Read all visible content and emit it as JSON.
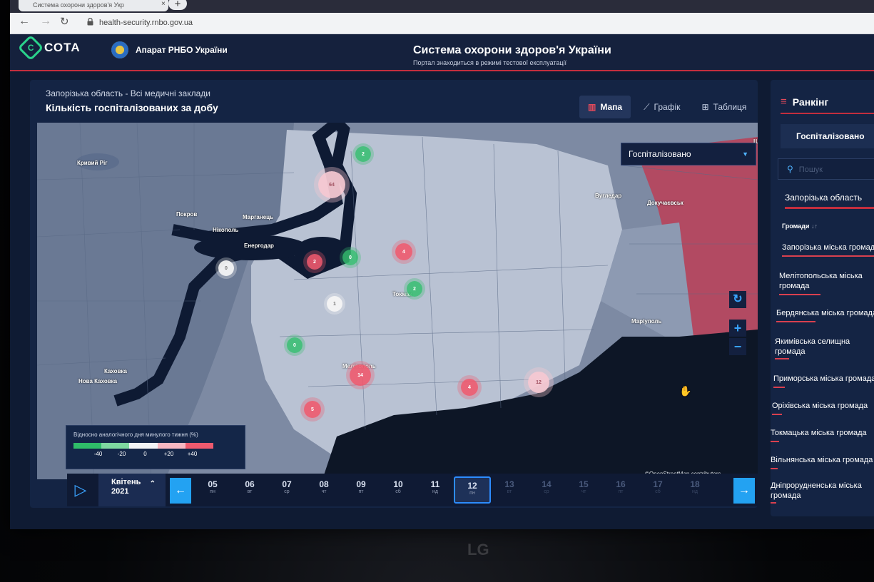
{
  "browser": {
    "tab_title": "Система охорони здоров'я Укр",
    "url": "health-security.rnbo.gov.ua"
  },
  "header": {
    "logo_text": "СОТА",
    "org_name": "Апарат РНБО України",
    "title": "Система охорони здоров'я України",
    "subtitle": "Портал знаходиться в режимі тестової експлуатації"
  },
  "main": {
    "breadcrumb": "Запорізька область - Всі медичні заклади",
    "title": "Кількість госпіталізованих за добу",
    "views": [
      {
        "label": "Мапа",
        "icon": "map-icon",
        "active": true
      },
      {
        "label": "Графік",
        "icon": "chart-icon",
        "active": false
      },
      {
        "label": "Таблиця",
        "icon": "table-icon",
        "active": false
      }
    ],
    "map_metric_select": "Госпіталізовано",
    "map_attribution": "©OpenStreetMap contributors",
    "map_place_labels": [
      "Кривий Ріг",
      "Покров",
      "Марганець",
      "Нікополь",
      "Енергодар",
      "Вугледар",
      "Докучаєвськ",
      "Токмак",
      "Маріуполь",
      "Мелітополь",
      "Каховка",
      "Нова Каховка",
      "Ша"
    ],
    "markers": [
      {
        "value": "2",
        "color": "green"
      },
      {
        "value": "64",
        "color": "pink"
      },
      {
        "value": "2",
        "color": "red"
      },
      {
        "value": "0",
        "color": "green"
      },
      {
        "value": "0",
        "color": "white"
      },
      {
        "value": "4",
        "color": "red"
      },
      {
        "value": "2",
        "color": "green"
      },
      {
        "value": "1",
        "color": "white"
      },
      {
        "value": "0",
        "color": "green"
      },
      {
        "value": "14",
        "color": "red"
      },
      {
        "value": "4",
        "color": "red"
      },
      {
        "value": "12",
        "color": "pink"
      },
      {
        "value": "5",
        "color": "red"
      }
    ],
    "legend": {
      "title": "Відносно аналогічного дня минулого тижня (%)",
      "ticks": [
        "-40",
        "-20",
        "0",
        "+20",
        "+40"
      ],
      "colors": [
        "#2fbd69",
        "#7ed8a0",
        "#f1f3f6",
        "#f7b7c2",
        "#ee5a6e"
      ]
    },
    "timeline": {
      "month": "Квітень",
      "year": "2021",
      "days": [
        {
          "num": "05",
          "dow": "пн",
          "state": "past"
        },
        {
          "num": "06",
          "dow": "вт",
          "state": "past"
        },
        {
          "num": "07",
          "dow": "ср",
          "state": "past"
        },
        {
          "num": "08",
          "dow": "чт",
          "state": "past"
        },
        {
          "num": "09",
          "dow": "пт",
          "state": "past"
        },
        {
          "num": "10",
          "dow": "сб",
          "state": "past"
        },
        {
          "num": "11",
          "dow": "нд",
          "state": "past"
        },
        {
          "num": "12",
          "dow": "пн",
          "state": "selected"
        },
        {
          "num": "13",
          "dow": "вт",
          "state": "future"
        },
        {
          "num": "14",
          "dow": "ср",
          "state": "future"
        },
        {
          "num": "15",
          "dow": "чт",
          "state": "future"
        },
        {
          "num": "16",
          "dow": "пт",
          "state": "future"
        },
        {
          "num": "17",
          "dow": "сб",
          "state": "future"
        },
        {
          "num": "18",
          "dow": "нд",
          "state": "future"
        }
      ]
    }
  },
  "ranking": {
    "title": "Ранкінг",
    "metric_button": "Госпіталізовано",
    "search_placeholder": "Пошук",
    "region": "Запорізька область",
    "group_label": "Громади",
    "items": [
      {
        "label": "Запорізька міська громада",
        "bar": 1.0
      },
      {
        "label": "Мелітопольська міська громада",
        "bar": 0.42
      },
      {
        "label": "Бердянська міська громада",
        "bar": 0.4
      },
      {
        "label": "Якимівська селищна громада",
        "bar": 0.15
      },
      {
        "label": "Приморська міська громада",
        "bar": 0.12
      },
      {
        "label": "Оріхівська міська громада",
        "bar": 0.1
      },
      {
        "label": "Токмацька міська громада",
        "bar": 0.08
      },
      {
        "label": "Вільнянська міська громада",
        "bar": 0.07
      },
      {
        "label": "Дніпрорудненська міська громада",
        "bar": 0.05
      }
    ]
  },
  "monitor_brand": "LG"
}
